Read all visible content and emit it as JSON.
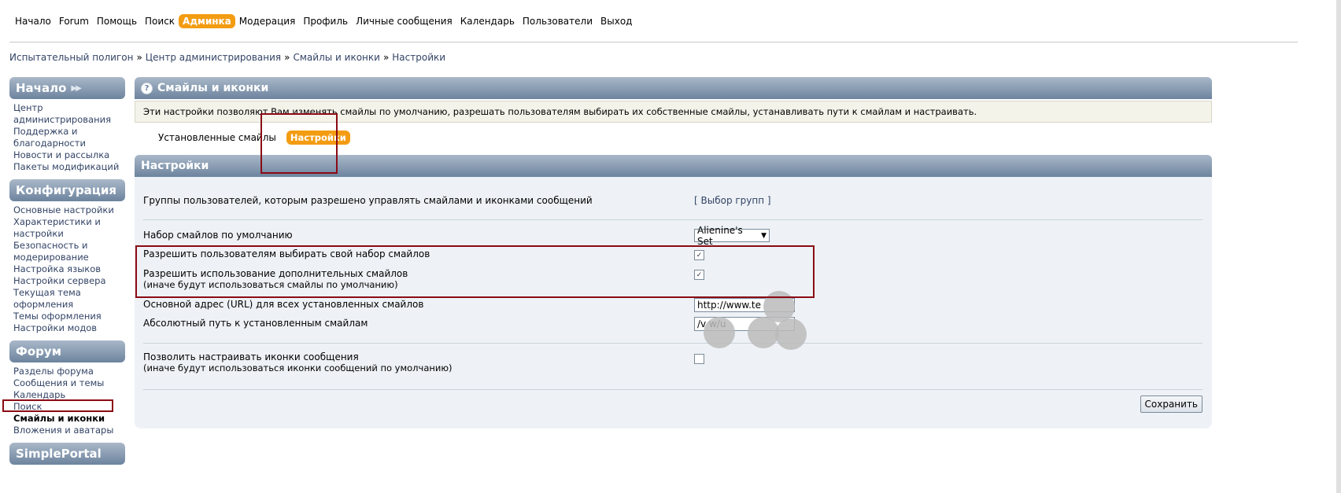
{
  "topnav": {
    "items": [
      "Начало",
      "Forum",
      "Помощь",
      "Поиск",
      "Админка",
      "Модерация",
      "Профиль",
      "Личные сообщения",
      "Календарь",
      "Пользователи",
      "Выход"
    ]
  },
  "breadcrumb": [
    "Испытательный полигон",
    "Центр администрирования",
    "Смайлы и иконки",
    "Настройки"
  ],
  "sidebar": {
    "sections": [
      {
        "title": "Начало",
        "links": [
          "Центр администрирования",
          "Поддержка и благодарности",
          "Новости и рассылка",
          "Пакеты модификаций"
        ]
      },
      {
        "title": "Конфигурация",
        "links": [
          "Основные настройки",
          "Характеристики и настройки",
          "Безопасность и модерирование",
          "Настройка языков",
          "Настройки сервера",
          "Текущая тема оформления",
          "Темы оформления",
          "Настройки модов"
        ]
      },
      {
        "title": "Форум",
        "links": [
          "Разделы форума",
          "Сообщения и темы",
          "Календарь",
          "Поиск",
          "Смайлы и иконки",
          "Вложения и аватары"
        ]
      },
      {
        "title": "SimplePortal",
        "links": []
      }
    ]
  },
  "main": {
    "title": "Смайлы и иконки",
    "info": "Эти настройки позволяют Вам изменять смайлы по умолчанию, разрешать пользователям выбирать их собственные смайлы, устанавливать пути к смайлам и настраивать.",
    "tabs": [
      "Установленные смайлы",
      "Настройки"
    ],
    "settings_title": "Настройки",
    "rows": {
      "groups_label": "Группы пользователей, которым разрешено управлять смайлами и иконками сообщений",
      "groups_link": "[ Выбор групп ]",
      "default_set_label": "Набор смайлов по умолчанию",
      "default_set_value": "Alienine's Set",
      "allow_choose_label": "Разрешить пользователям выбирать свой набор смайлов",
      "allow_extra_label": "Разрешить использование дополнительных смайлов",
      "allow_extra_sub": "(иначе будут использоваться смайлы по умолчанию)",
      "url_label": "Основной адрес (URL) для всех установленных смайлов",
      "url_value": "http://www.te",
      "path_label": "Абсолютный путь к установленным смайлам",
      "path_value": "/v        w/u",
      "icons_label": "Позволить настраивать иконки сообщения",
      "icons_sub": "(иначе будут использоваться иконки сообщений по умолчанию)"
    },
    "checkboxes": {
      "allow_choose": true,
      "allow_extra": true,
      "icons": false
    },
    "save_label": "Сохранить"
  },
  "colors": {
    "accent": "#f39c12",
    "header": "#6d849e",
    "highlight_box": "#8b0a14"
  }
}
